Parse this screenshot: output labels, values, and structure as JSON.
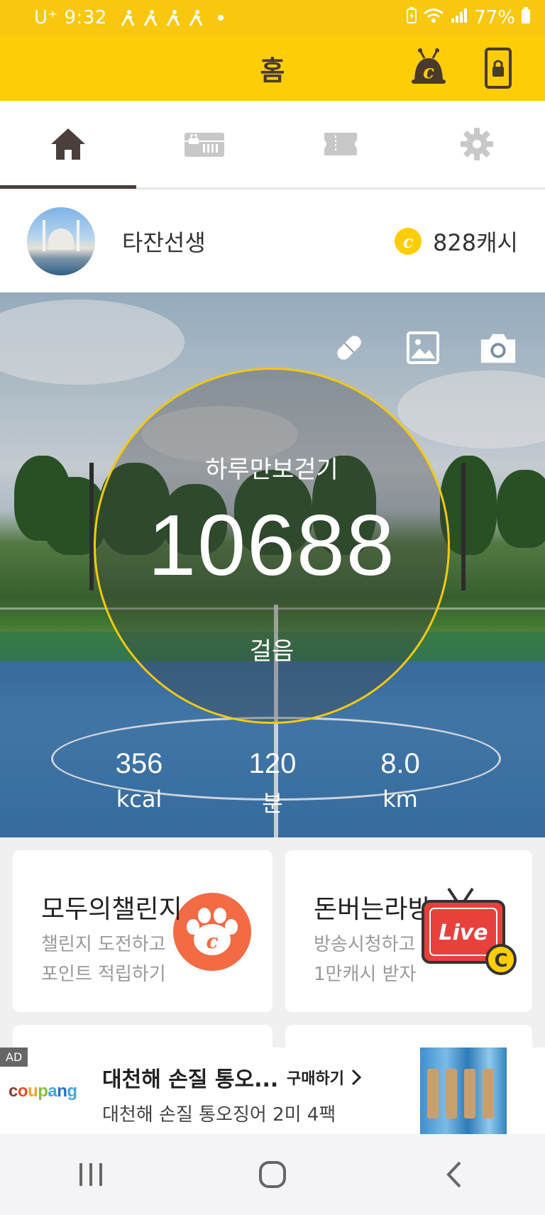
{
  "status_bar": {
    "carrier": "U⁺ 9:32",
    "battery": "77%"
  },
  "header": {
    "title": "홈"
  },
  "tabs": [
    {
      "icon": "home-icon",
      "active": true
    },
    {
      "icon": "coupon-ticket-icon",
      "active": false
    },
    {
      "icon": "ticket-icon",
      "active": false
    },
    {
      "icon": "gear-icon",
      "active": false
    }
  ],
  "profile": {
    "name": "타잔선생",
    "cash": "828캐시",
    "coin_symbol": "c"
  },
  "hero": {
    "goal_label": "하루만보걷기",
    "steps": "10688",
    "steps_unit": "걸음",
    "stats": [
      {
        "value": "356",
        "unit": "kcal"
      },
      {
        "value": "120",
        "unit": "분"
      },
      {
        "value": "8.0",
        "unit": "km"
      }
    ]
  },
  "cards": {
    "challenge": {
      "title": "모두의챌린지",
      "line1": "챌린지 도전하고",
      "line2": "포인트 적립하기"
    },
    "live": {
      "title": "돈버는라방",
      "line1": "방송시청하고",
      "line2": "1만캐시 받자",
      "badge": "Live"
    }
  },
  "ad": {
    "label": "AD",
    "brand": "coupang",
    "headline": "대천해 손질 통오...",
    "cta": "구매하기",
    "subline": "대천해 손질 통오징어 2미 4팩"
  },
  "colors": {
    "brand_yellow": "#fdcd08",
    "ring_yellow": "#f3c90f",
    "header_text": "#4a3a2a",
    "paw_orange": "#f36b45",
    "live_red": "#e8413c"
  }
}
